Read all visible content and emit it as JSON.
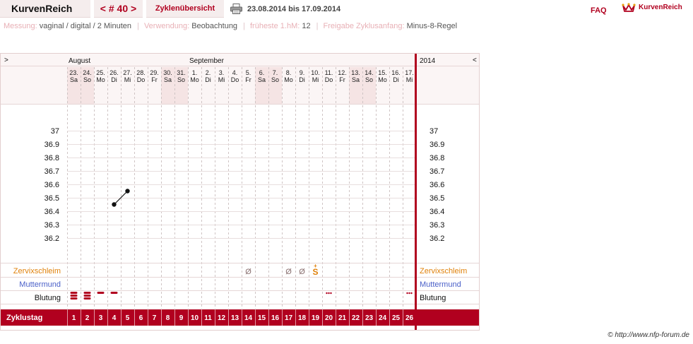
{
  "app": {
    "title": "KurvenReich",
    "cycle_nav": "< # 40 >",
    "overview_label": "Zyklenübersicht",
    "date_range": "23.08.2014 bis 17.09.2014",
    "faq_label": "FAQ",
    "brand_label": "KurvenReich"
  },
  "info": {
    "measurement_label": "Messung:",
    "measurement_value": "vaginal / digital / 2 Minuten",
    "usage_label": "Verwendung:",
    "usage_value": "Beobachtung",
    "earliest_label": "früheste 1.hM:",
    "earliest_value": "12",
    "release_label": "Freigabe Zyklusanfang:",
    "release_value": "Minus-8-Regel"
  },
  "chart": {
    "nav_left": ">",
    "nav_right": "<",
    "year": "2014",
    "months": [
      {
        "label": "August",
        "start_day_index": 0
      },
      {
        "label": "September",
        "start_day_index": 9
      }
    ],
    "days": [
      {
        "date": "23.",
        "weekday": "Sa",
        "weekend": true
      },
      {
        "date": "24.",
        "weekday": "So",
        "weekend": true
      },
      {
        "date": "25.",
        "weekday": "Mo",
        "weekend": false
      },
      {
        "date": "26.",
        "weekday": "Di",
        "weekend": false
      },
      {
        "date": "27.",
        "weekday": "Mi",
        "weekend": false
      },
      {
        "date": "28.",
        "weekday": "Do",
        "weekend": false
      },
      {
        "date": "29.",
        "weekday": "Fr",
        "weekend": false
      },
      {
        "date": "30.",
        "weekday": "Sa",
        "weekend": true
      },
      {
        "date": "31.",
        "weekday": "So",
        "weekend": true
      },
      {
        "date": "1.",
        "weekday": "Mo",
        "weekend": false
      },
      {
        "date": "2.",
        "weekday": "Di",
        "weekend": false
      },
      {
        "date": "3.",
        "weekday": "Mi",
        "weekend": false
      },
      {
        "date": "4.",
        "weekday": "Do",
        "weekend": false
      },
      {
        "date": "5.",
        "weekday": "Fr",
        "weekend": false
      },
      {
        "date": "6.",
        "weekday": "Sa",
        "weekend": true
      },
      {
        "date": "7.",
        "weekday": "So",
        "weekend": true
      },
      {
        "date": "8.",
        "weekday": "Mo",
        "weekend": false
      },
      {
        "date": "9.",
        "weekday": "Di",
        "weekend": false
      },
      {
        "date": "10.",
        "weekday": "Mi",
        "weekend": false
      },
      {
        "date": "11.",
        "weekday": "Do",
        "weekend": false
      },
      {
        "date": "12.",
        "weekday": "Fr",
        "weekend": false
      },
      {
        "date": "13.",
        "weekday": "Sa",
        "weekend": true
      },
      {
        "date": "14.",
        "weekday": "So",
        "weekend": true
      },
      {
        "date": "15.",
        "weekday": "Mo",
        "weekend": false
      },
      {
        "date": "16.",
        "weekday": "Di",
        "weekend": false
      },
      {
        "date": "17.",
        "weekday": "Mi",
        "weekend": false
      }
    ],
    "temperature_ticks": [
      "37",
      "36.9",
      "36.8",
      "36.7",
      "36.6",
      "36.5",
      "36.4",
      "36.3",
      "36.2"
    ],
    "row_labels": {
      "cervical": "Zervixschleim",
      "cervix": "Muttermund",
      "bleeding": "Blutung",
      "cycle_day": "Zyklustag"
    },
    "cycle_days": [
      "1",
      "2",
      "3",
      "4",
      "5",
      "6",
      "7",
      "8",
      "9",
      "10",
      "11",
      "12",
      "13",
      "14",
      "15",
      "16",
      "17",
      "18",
      "19",
      "20",
      "21",
      "22",
      "23",
      "24",
      "25",
      "26"
    ],
    "cervical_marks": [
      {
        "day_index": 13,
        "symbol": "Ø"
      },
      {
        "day_index": 16,
        "symbol": "Ø"
      },
      {
        "day_index": 17,
        "symbol": "Ø"
      },
      {
        "day_index": 18,
        "symbol": "S+"
      }
    ],
    "bleeding_marks": [
      {
        "day_index": 0,
        "level": "heavy"
      },
      {
        "day_index": 1,
        "level": "heavy"
      },
      {
        "day_index": 2,
        "level": "light"
      },
      {
        "day_index": 3,
        "level": "light"
      },
      {
        "day_index": 19,
        "level": "spotting"
      },
      {
        "day_index": 25,
        "level": "spotting"
      }
    ],
    "colors": {
      "accent": "#b1001f",
      "weekend": "#f5e4e4",
      "cervical": "#e0810a",
      "cervix": "#4a60c8",
      "grid": "#cfc4c4"
    }
  },
  "chart_data": {
    "type": "line",
    "x": [
      "26.",
      "27."
    ],
    "series": [
      {
        "values": [
          36.45,
          36.55
        ]
      }
    ],
    "ylim": [
      36.2,
      37.0
    ]
  },
  "footer": {
    "copyright": "© http://www.nfp-forum.de"
  }
}
